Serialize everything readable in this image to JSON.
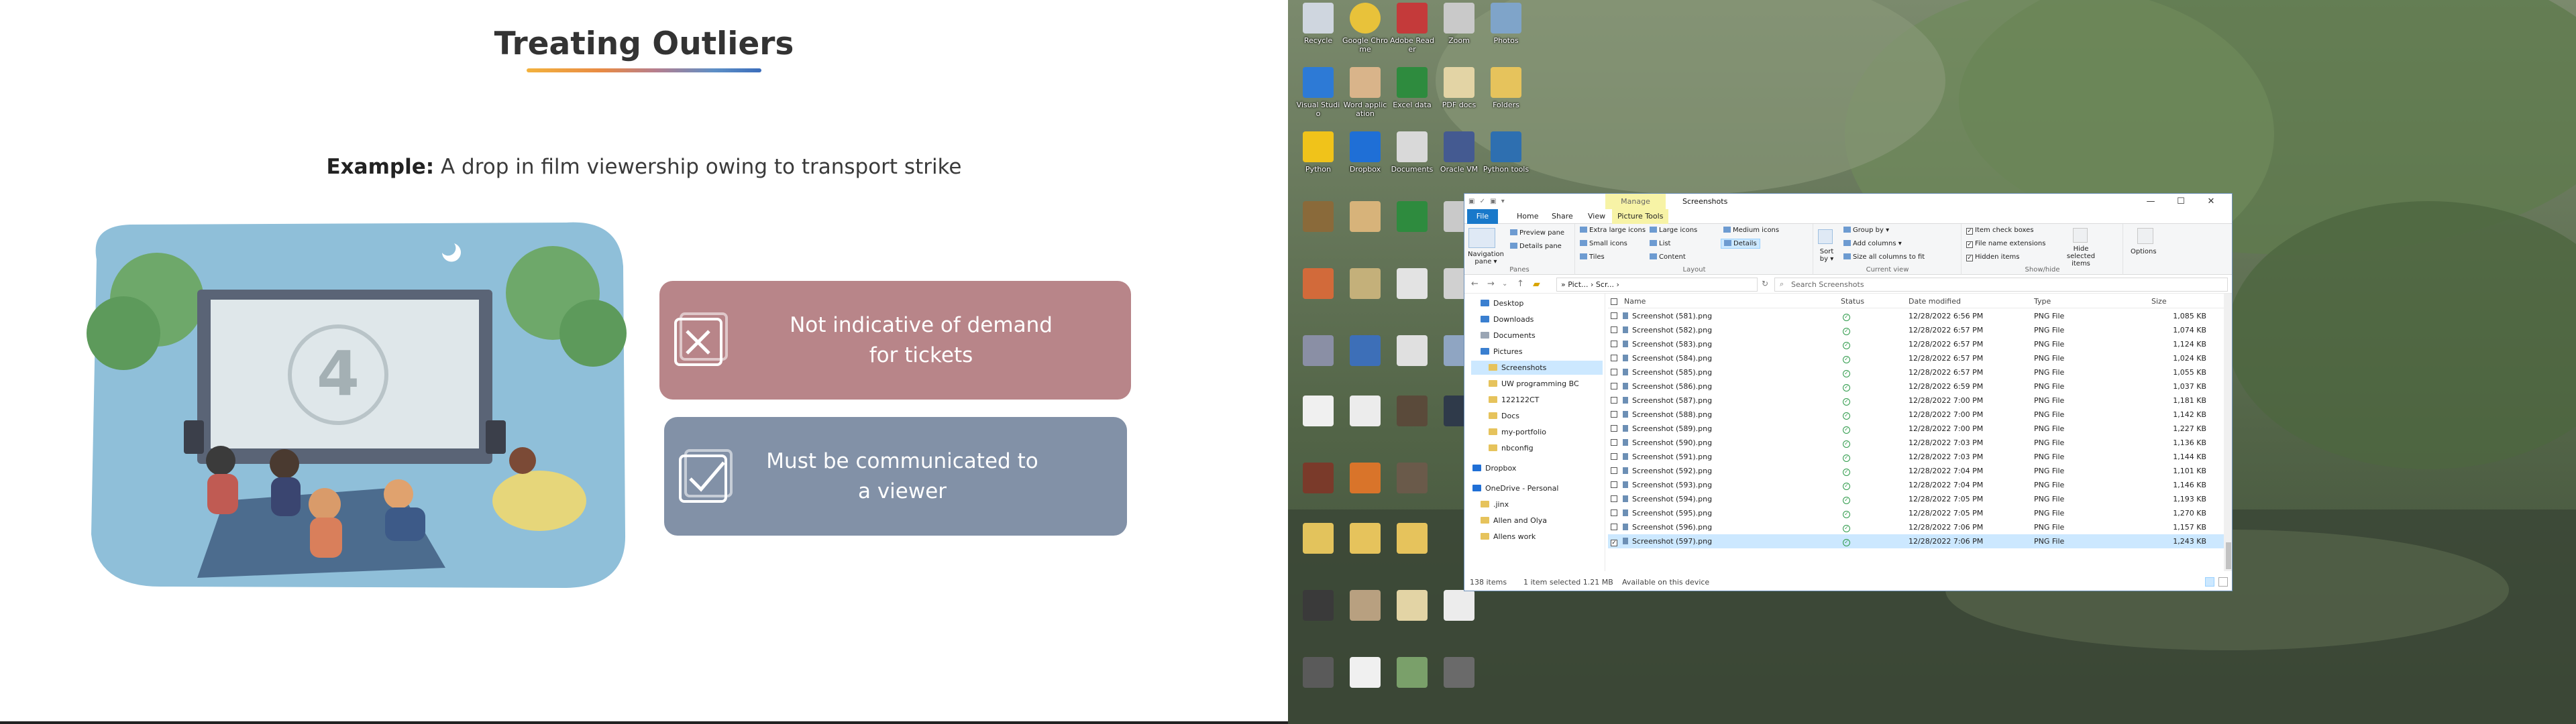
{
  "slide": {
    "title": "Treating Outliers",
    "example_prefix": "Example:",
    "example_text": "A drop in film viewership owing to transport strike",
    "card_not_indicative": "Not indicative of demand for tickets",
    "card_must_communicate": "Must be communicated to a viewer",
    "screen_number": "4",
    "colors": {
      "card_red": "#b88589",
      "card_blue": "#8291a7",
      "title": "#333333"
    }
  },
  "desktop": {
    "icons": [
      {
        "label": "Recycle",
        "color": "#cfd6df"
      },
      {
        "label": "Google Chrome",
        "color": "#e8c23a"
      },
      {
        "label": "Adobe Reader",
        "color": "#c43a3a"
      },
      {
        "label": "Zoom",
        "color": "#c9c9c9"
      },
      {
        "label": "Photos",
        "color": "#7fa4c9"
      },
      {
        "label": "Visual Studio",
        "color": "#2d7ad6"
      },
      {
        "label": "Word application",
        "color": "#d9b48a"
      },
      {
        "label": "Excel data",
        "color": "#2e8b3e"
      },
      {
        "label": "PDF docs",
        "color": "#e3d4a5"
      },
      {
        "label": "Folders",
        "color": "#e6c35c"
      },
      {
        "label": "Python",
        "color": "#f0c31a"
      },
      {
        "label": "Dropbox",
        "color": "#1f6fd6"
      },
      {
        "label": "Documents",
        "color": "#d9d9d9"
      },
      {
        "label": "Oracle VM",
        "color": "#445a91"
      },
      {
        "label": "Python tools",
        "color": "#2e6fb0"
      }
    ]
  },
  "explorer": {
    "qat": "▣ ✓ ▣ ▾",
    "manage_tab": "Manage",
    "window_title": "Screenshots",
    "minimize": "—",
    "maximize": "☐",
    "close": "✕",
    "tabs": [
      "File",
      "Home",
      "Share",
      "View",
      "Picture Tools"
    ],
    "ribbon": {
      "panes": {
        "navigation": "Navigation pane ▾",
        "preview": "Preview pane",
        "details": "Details pane",
        "label": "Panes"
      },
      "layout": {
        "items": [
          "Extra large icons",
          "Large icons",
          "Medium icons",
          "Small icons",
          "List",
          "Details",
          "Tiles",
          "Content"
        ],
        "label": "Layout"
      },
      "current_view": {
        "sort": "Sort by ▾",
        "group": "Group by ▾",
        "add_columns": "Add columns ▾",
        "size_columns": "Size all columns to fit",
        "label": "Current view"
      },
      "show_hide": {
        "item_check": "Item check boxes",
        "extensions": "File name extensions",
        "hidden": "Hidden items",
        "hide_selected": "Hide selected items",
        "options": "Options",
        "label": "Show/hide"
      }
    },
    "address": "» Pict... › Scr... ›",
    "search_placeholder": "Search Screenshots",
    "nav": [
      {
        "label": "Desktop",
        "color": "#3a7fd0"
      },
      {
        "label": "Downloads",
        "color": "#3a7fd0"
      },
      {
        "label": "Documents",
        "color": "#9aa5b4"
      },
      {
        "label": "Pictures",
        "color": "#3a7fd0"
      },
      {
        "label": "Screenshots",
        "color": "#e6c35c",
        "selected": true
      },
      {
        "label": "UW programming BC",
        "color": "#e6c35c"
      },
      {
        "label": "122122CT",
        "color": "#e6c35c"
      },
      {
        "label": "Docs",
        "color": "#e6c35c"
      },
      {
        "label": "my-portfolio",
        "color": "#e6c35c"
      },
      {
        "label": "nbconfig",
        "color": "#e6c35c"
      },
      {
        "label": "Dropbox",
        "color": "#1f6fd6"
      },
      {
        "label": "OneDrive - Personal",
        "color": "#1f6fd6"
      },
      {
        "label": ".jinx",
        "color": "#e6c35c"
      },
      {
        "label": "Allen and Olya",
        "color": "#e6c35c"
      },
      {
        "label": "Allens work",
        "color": "#e6c35c"
      }
    ],
    "columns": {
      "name": "Name",
      "status": "Status",
      "date": "Date modified",
      "type": "Type",
      "size": "Size"
    },
    "files": [
      {
        "name": "Screenshot (581).png",
        "date": "12/28/2022 6:56 PM",
        "type": "PNG File",
        "size": "1,085 KB"
      },
      {
        "name": "Screenshot (582).png",
        "date": "12/28/2022 6:57 PM",
        "type": "PNG File",
        "size": "1,074 KB"
      },
      {
        "name": "Screenshot (583).png",
        "date": "12/28/2022 6:57 PM",
        "type": "PNG File",
        "size": "1,124 KB"
      },
      {
        "name": "Screenshot (584).png",
        "date": "12/28/2022 6:57 PM",
        "type": "PNG File",
        "size": "1,024 KB"
      },
      {
        "name": "Screenshot (585).png",
        "date": "12/28/2022 6:57 PM",
        "type": "PNG File",
        "size": "1,055 KB"
      },
      {
        "name": "Screenshot (586).png",
        "date": "12/28/2022 6:59 PM",
        "type": "PNG File",
        "size": "1,037 KB"
      },
      {
        "name": "Screenshot (587).png",
        "date": "12/28/2022 7:00 PM",
        "type": "PNG File",
        "size": "1,181 KB"
      },
      {
        "name": "Screenshot (588).png",
        "date": "12/28/2022 7:00 PM",
        "type": "PNG File",
        "size": "1,142 KB"
      },
      {
        "name": "Screenshot (589).png",
        "date": "12/28/2022 7:00 PM",
        "type": "PNG File",
        "size": "1,227 KB"
      },
      {
        "name": "Screenshot (590).png",
        "date": "12/28/2022 7:03 PM",
        "type": "PNG File",
        "size": "1,136 KB"
      },
      {
        "name": "Screenshot (591).png",
        "date": "12/28/2022 7:03 PM",
        "type": "PNG File",
        "size": "1,144 KB"
      },
      {
        "name": "Screenshot (592).png",
        "date": "12/28/2022 7:04 PM",
        "type": "PNG File",
        "size": "1,101 KB"
      },
      {
        "name": "Screenshot (593).png",
        "date": "12/28/2022 7:04 PM",
        "type": "PNG File",
        "size": "1,146 KB"
      },
      {
        "name": "Screenshot (594).png",
        "date": "12/28/2022 7:05 PM",
        "type": "PNG File",
        "size": "1,193 KB"
      },
      {
        "name": "Screenshot (595).png",
        "date": "12/28/2022 7:05 PM",
        "type": "PNG File",
        "size": "1,270 KB"
      },
      {
        "name": "Screenshot (596).png",
        "date": "12/28/2022 7:06 PM",
        "type": "PNG File",
        "size": "1,157 KB"
      },
      {
        "name": "Screenshot (597).png",
        "date": "12/28/2022 7:06 PM",
        "type": "PNG File",
        "size": "1,243 KB",
        "selected": true
      }
    ],
    "status": {
      "items": "138 items",
      "selected": "1 item selected  1.21 MB",
      "availability": "Available on this device"
    }
  }
}
